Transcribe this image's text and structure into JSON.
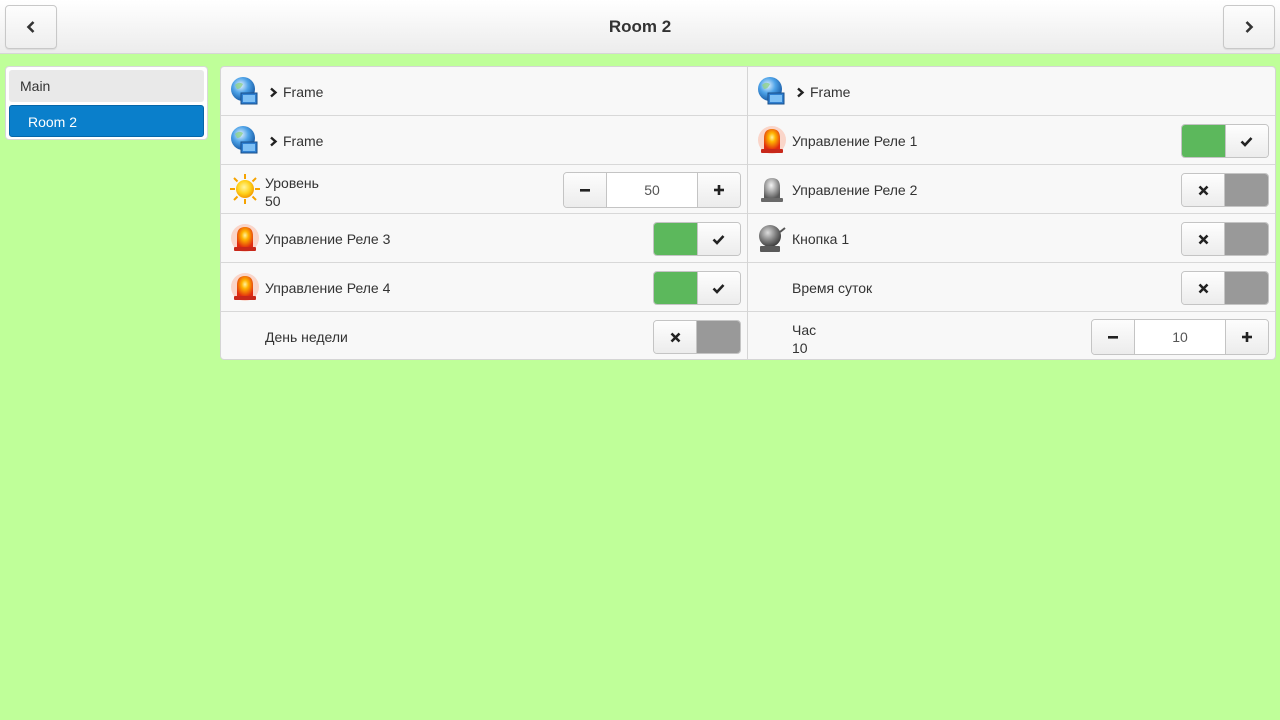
{
  "header": {
    "title": "Room 2",
    "prev_icon": "chevron-left-icon",
    "next_icon": "chevron-right-icon"
  },
  "sidebar": {
    "items": [
      {
        "label": "Main",
        "active": false
      },
      {
        "label": "Room 2",
        "active": true
      }
    ]
  },
  "left_column": {
    "frame1": {
      "label": "Frame",
      "icon": "globe-network-icon"
    },
    "frame2": {
      "label": "Frame",
      "icon": "globe-network-icon"
    },
    "level": {
      "label": "Уровень",
      "value": "50",
      "stepper_value": "50",
      "icon": "sun-icon"
    },
    "relay3": {
      "label": "Управление Реле 3",
      "icon": "alarm-light-on-icon",
      "state": "on"
    },
    "relay4": {
      "label": "Управление Реле 4",
      "icon": "alarm-light-on-icon",
      "state": "on"
    },
    "weekday": {
      "label": "День недели",
      "state": "off"
    }
  },
  "right_column": {
    "frame3": {
      "label": "Frame",
      "icon": "globe-network-icon"
    },
    "relay1": {
      "label": "Управление Реле 1",
      "icon": "alarm-light-on-icon",
      "state": "on"
    },
    "relay2": {
      "label": "Управление Реле 2",
      "icon": "alarm-light-off-icon",
      "state": "off"
    },
    "button1": {
      "label": "Кнопка 1",
      "icon": "bell-icon",
      "state": "off"
    },
    "daytime": {
      "label": "Время суток",
      "state": "off"
    },
    "hour": {
      "label": "Час",
      "value": "10",
      "stepper_value": "10"
    }
  },
  "colors": {
    "background": "#bfff99",
    "active_nav": "#0a7fcb",
    "toggle_on": "#5cb85c",
    "toggle_off": "#999999"
  }
}
